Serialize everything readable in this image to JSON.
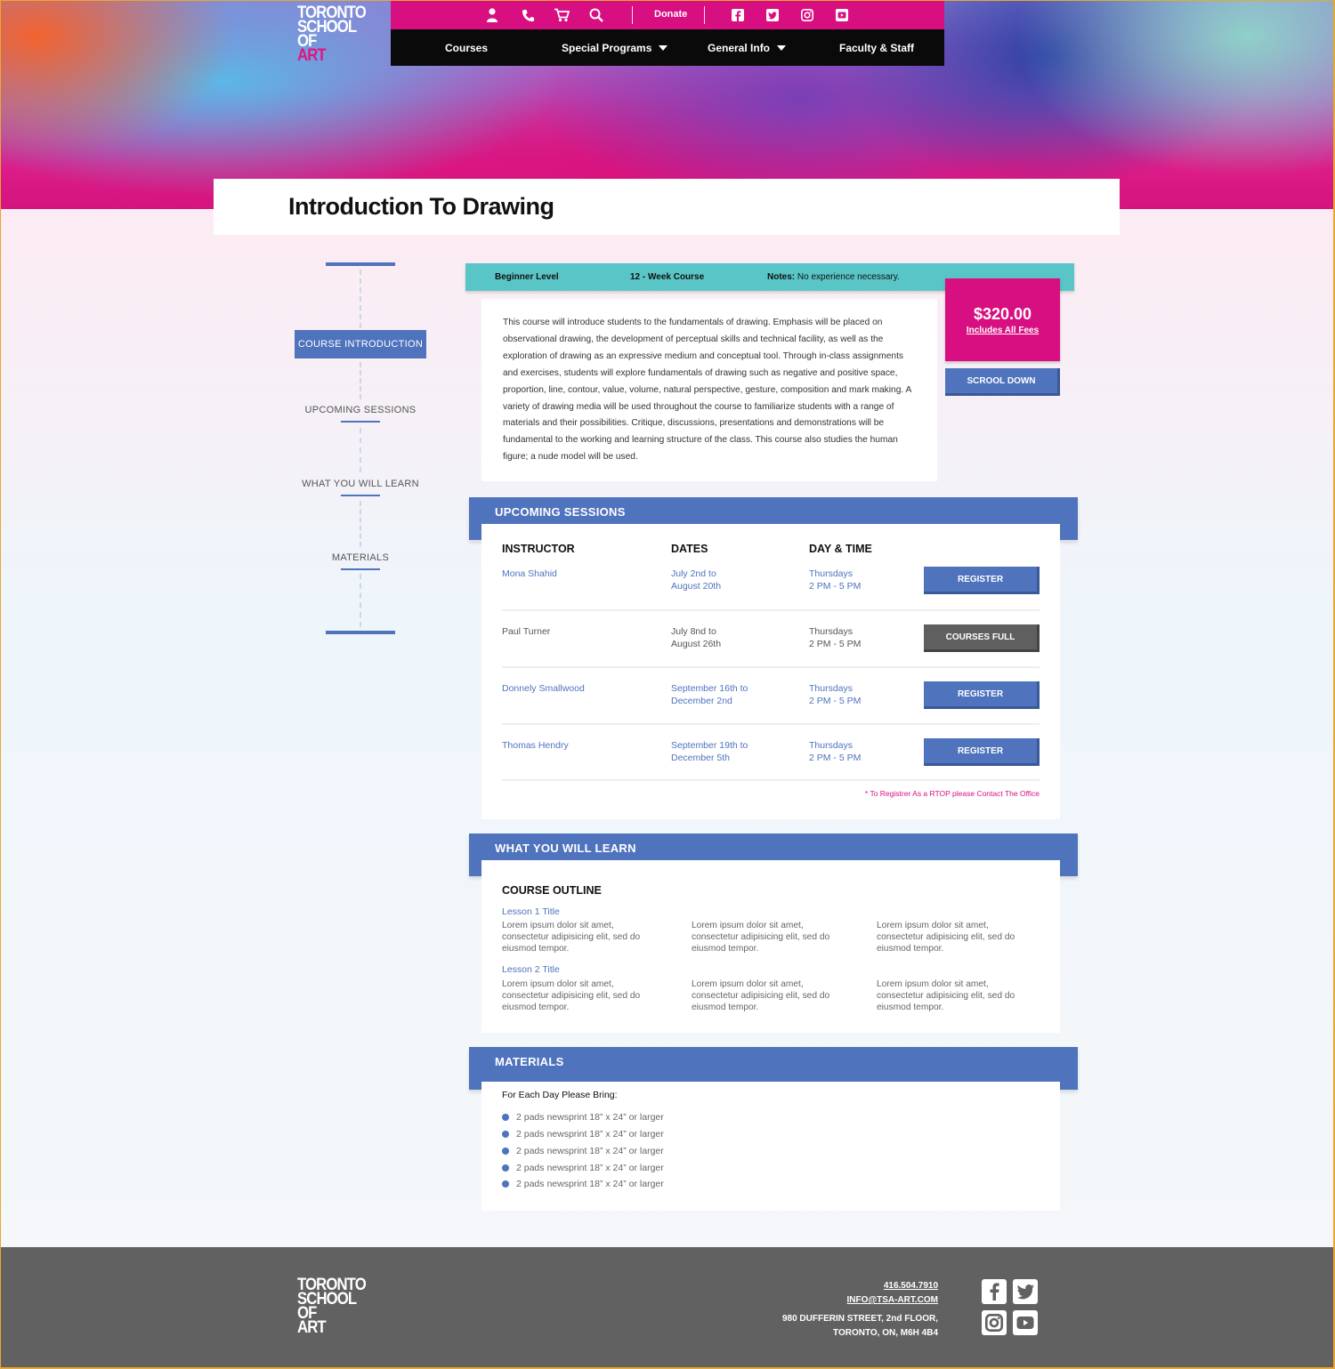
{
  "brand": {
    "logo_lines": [
      "TORONTO",
      "SCHOOL",
      "OF",
      "ART"
    ],
    "accent": "#d80f80",
    "blue": "#4f73bd",
    "teal": "#5ac5c6"
  },
  "topbar": {
    "icons": [
      "user-icon",
      "phone-icon",
      "cart-icon",
      "search-icon"
    ],
    "donate_label": "Donate",
    "social": [
      "facebook-icon",
      "twitter-icon",
      "instagram-icon",
      "youtube-icon"
    ]
  },
  "nav": {
    "courses": "Courses",
    "special_programs": "Special Programs",
    "general_info": "General Info",
    "faculty_staff": "Faculty & Staff"
  },
  "page_title": "Introduction To Drawing",
  "sidenav": {
    "items": [
      "COURSE INTRODUCTION",
      "UPCOMING SESSIONS",
      "WHAT YOU WILL LEARN",
      "MATERIALS"
    ]
  },
  "info_strip": {
    "level": "Beginner Level",
    "duration": "12 - Week Course",
    "notes_label": "Notes:",
    "notes_value": "No experience necessary."
  },
  "description": "This course will introduce students to the fundamentals of drawing. Emphasis will be placed on observational drawing, the development of perceptual skills and technical facility, as well as the exploration of drawing as an expressive medium and conceptual tool. Through in-class assignments and exercises, students will explore fundamentals of drawing such as negative and positive space, proportion, line, contour, value, volume, natural perspective, gesture, composition and mark making. A variety of drawing media will be used throughout the course to familiarize students with a range of materials and their possibilities. Critique, discussions, presentations and demonstrations will be fundamental to the working and learning structure of the class. This course also studies the human figure; a nude model will be used.",
  "price": {
    "amount": "$320.00",
    "fees_label": "Includes All Fees"
  },
  "scroll_button": "SCROOL DOWN",
  "sessions": {
    "title": "UPCOMING SESSIONS",
    "headers": [
      "INSTRUCTOR",
      "DATES",
      "DAY & TIME"
    ],
    "rows": [
      {
        "instructor": "Mona Shahid",
        "dates_1": "July 2nd to",
        "dates_2": "August 20th",
        "day": "Thursdays",
        "time": "2 PM - 5 PM",
        "button": "REGISTER",
        "status": "open"
      },
      {
        "instructor": "Paul Turner",
        "dates_1": "July 8nd to",
        "dates_2": "August 26th",
        "day": "Thursdays",
        "time": "2 PM - 5 PM",
        "button": "COURSES FULL",
        "status": "full"
      },
      {
        "instructor": "Donnely Smallwood",
        "dates_1": "September 16th to",
        "dates_2": "December 2nd",
        "day": "Thursdays",
        "time": "2 PM - 5 PM",
        "button": "REGISTER",
        "status": "open"
      },
      {
        "instructor": "Thomas Hendry",
        "dates_1": "September 19th to",
        "dates_2": "December 5th",
        "day": "Thursdays",
        "time": "2 PM - 5 PM",
        "button": "REGISTER",
        "status": "open"
      }
    ],
    "note": "* To Registrer As a RTOP please Contact The Office"
  },
  "learn": {
    "title": "WHAT YOU WILL LEARN",
    "outline_title": "COURSE OUTLINE",
    "lessons": [
      {
        "title": "Lesson 1 Title",
        "cols": [
          "Lorem ipsum dolor sit amet, consectetur adipisicing elit, sed do eiusmod tempor.",
          "Lorem ipsum dolor sit amet, consectetur adipisicing elit, sed do eiusmod tempor.",
          "Lorem ipsum dolor sit amet, consectetur adipisicing elit, sed do eiusmod tempor."
        ]
      },
      {
        "title": "Lesson 2 Title",
        "cols": [
          "Lorem ipsum dolor sit amet, consectetur adipisicing elit, sed do eiusmod tempor.",
          "Lorem ipsum dolor sit amet, consectetur adipisicing elit, sed do eiusmod tempor.",
          "Lorem ipsum dolor sit amet, consectetur adipisicing elit, sed do eiusmod tempor."
        ]
      }
    ]
  },
  "materials": {
    "title": "MATERIALS",
    "heading": "For Each Day Please Bring:",
    "items": [
      "2 pads newsprint 18” x 24” or larger",
      "2 pads newsprint 18” x 24” or larger",
      "2 pads newsprint 18” x 24” or larger",
      "2 pads newsprint 18” x 24” or larger",
      "2 pads newsprint 18” x 24” or larger"
    ]
  },
  "footer": {
    "logo_lines": [
      "TORONTO",
      "SCHOOL",
      "OF",
      "ART"
    ],
    "phone": "416.504.7910",
    "email": "INFO@TSA-ART.COM",
    "address_1": "980 DUFFERIN STREET, 2nd FLOOR,",
    "address_2": "TORONTO, ON, M6H 4B4",
    "social": [
      "facebook-icon",
      "twitter-icon",
      "instagram-icon",
      "youtube-icon"
    ]
  }
}
